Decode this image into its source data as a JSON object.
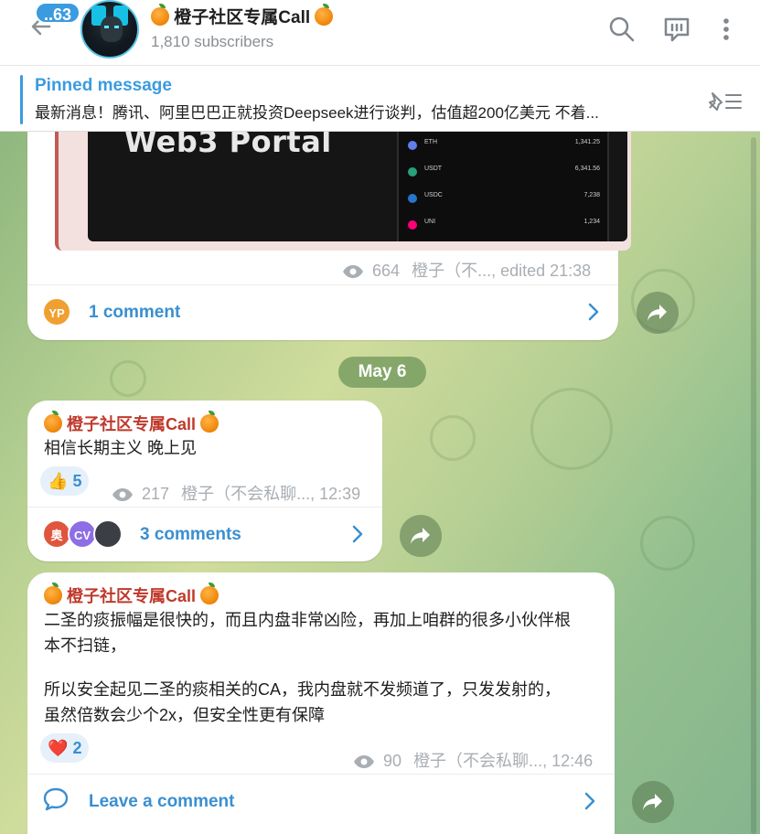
{
  "header": {
    "unread_count": "..63",
    "title": "橙子社区专属Call",
    "subscribers": "1,810 subscribers"
  },
  "pinned": {
    "label": "Pinned message",
    "text": "最新消息！腾讯、阿里巴巴正就投资Deepseek进行谈判，估值超200亿美元  不着..."
  },
  "image_post": {
    "image_text": "Web3 Portal",
    "coins": [
      {
        "name": "ETH",
        "value": "1,341.25",
        "color": "#627eea"
      },
      {
        "name": "USDT",
        "value": "6,341.56",
        "color": "#26a17b"
      },
      {
        "name": "USDC",
        "value": "7,238",
        "color": "#2775ca"
      },
      {
        "name": "UNI",
        "value": "1,234",
        "color": "#ff007a"
      }
    ],
    "views": "664",
    "signature": "橙子（不..., edited 21:38",
    "comment_avatar": "YP",
    "comments_label": "1 comment"
  },
  "date_separator": "May 6",
  "post1": {
    "sender": "橙子社区专属Call",
    "text": "相信长期主义 晚上见",
    "reaction_emoji": "👍",
    "reaction_count": "5",
    "views": "217",
    "signature": "橙子（不会私聊..., 12:39",
    "avatars": [
      "奥",
      "CV",
      ""
    ],
    "comments_label": "3 comments"
  },
  "post2": {
    "sender": "橙子社区专属Call",
    "line1": "二圣的痰振幅是很快的，而且内盘非常凶险，再加上咱群的很多小伙伴根",
    "line2": "本不扫链，",
    "line3": "所以安全起见二圣的痰相关的CA，我内盘就不发频道了，只发发射的，",
    "line4": "虽然倍数会少个2x，但安全性更有保障",
    "reaction_emoji": "❤️",
    "reaction_count": "2",
    "views": "90",
    "signature": "橙子（不会私聊..., 12:46",
    "comments_label": "Leave a comment"
  }
}
